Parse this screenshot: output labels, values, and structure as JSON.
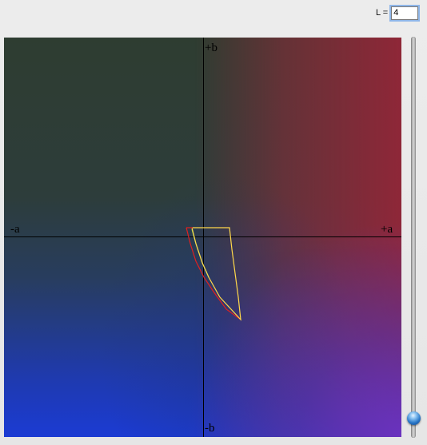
{
  "controls": {
    "l_label": "L =",
    "l_value": "4"
  },
  "plane": {
    "axis_labels": {
      "plus_b": "+b",
      "minus_b": "-b",
      "minus_a": "-a",
      "plus_a": "+a"
    },
    "colors": {
      "red_corner": "#8e2a38",
      "green_corner": "#2e3d31",
      "blue_corner": "#1b3bd3",
      "purple_corner": "#6a36c4",
      "axis": "#000000",
      "gamut_outline_red": "#e02020",
      "gamut_outline_yellow": "#ffd84a",
      "gamut_outline_green": "#7fd04a"
    }
  },
  "slider": {
    "value_fraction": 0.02
  }
}
